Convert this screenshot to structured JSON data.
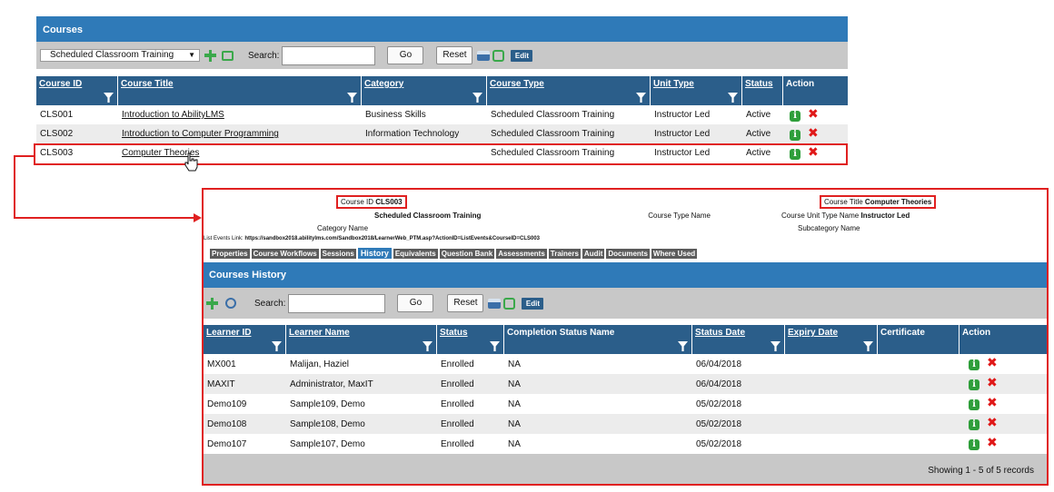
{
  "courses": {
    "title": "Courses",
    "filter_select": "Scheduled Classroom Training",
    "search_label": "Search:",
    "search_value": "",
    "go_label": "Go",
    "reset_label": "Reset",
    "edit_label": "Edit",
    "columns": [
      "Course ID",
      "Course Title",
      "Category",
      "Course Type",
      "Unit Type",
      "Status",
      "Action"
    ],
    "rows": [
      {
        "id": "CLS001",
        "title": "Introduction to AbilityLMS",
        "category": "Business Skills",
        "type": "Scheduled Classroom Training",
        "unit": "Instructor Led",
        "status": "Active"
      },
      {
        "id": "CLS002",
        "title": "Introduction to Computer Programming",
        "category": "Information Technology",
        "type": "Scheduled Classroom Training",
        "unit": "Instructor Led",
        "status": "Active"
      },
      {
        "id": "CLS003",
        "title": "Computer Theories",
        "category": "",
        "type": "Scheduled Classroom Training",
        "unit": "Instructor Led",
        "status": "Active"
      }
    ]
  },
  "detail": {
    "course_id_label": "Course ID",
    "course_id_value": "CLS003",
    "course_type_label": "Course Type Name",
    "course_type_value": "Scheduled Classroom Training",
    "category_label": "Category Name",
    "category_value": "",
    "course_title_label": "Course Title",
    "course_title_value": "Computer Theories",
    "unit_type_label": "Course Unit Type Name",
    "unit_type_value": "Instructor Led",
    "subcategory_label": "Subcategory Name",
    "subcategory_value": "",
    "list_events_label": "List Events Link:",
    "list_events_value": "https://sandbox2018.abilitylms.com/Sandbox2018/LearnerWeb_PTM.asp?ActionID=ListEvents&CourseID=CLS003",
    "tabs": [
      "Properties",
      "Course Workflows",
      "Sessions",
      "History",
      "Equivalents",
      "Question Bank",
      "Assessments",
      "Trainers",
      "Audit",
      "Documents",
      "Where Used"
    ],
    "active_tab": "History"
  },
  "history": {
    "title": "Courses History",
    "search_label": "Search:",
    "search_value": "",
    "go_label": "Go",
    "reset_label": "Reset",
    "edit_label": "Edit",
    "columns": [
      "Learner ID",
      "Learner Name",
      "Status",
      "Completion Status Name",
      "Status Date",
      "Expiry Date",
      "Certificate",
      "Action"
    ],
    "rows": [
      {
        "id": "MX001",
        "name": "Malijan, Haziel",
        "status": "Enrolled",
        "completion": "NA",
        "date": "06/04/2018",
        "expiry": "",
        "cert": ""
      },
      {
        "id": "MAXIT",
        "name": "Administrator, MaxIT",
        "status": "Enrolled",
        "completion": "NA",
        "date": "06/04/2018",
        "expiry": "",
        "cert": ""
      },
      {
        "id": "Demo109",
        "name": "Sample109, Demo",
        "status": "Enrolled",
        "completion": "NA",
        "date": "05/02/2018",
        "expiry": "",
        "cert": ""
      },
      {
        "id": "Demo108",
        "name": "Sample108, Demo",
        "status": "Enrolled",
        "completion": "NA",
        "date": "05/02/2018",
        "expiry": "",
        "cert": ""
      },
      {
        "id": "Demo107",
        "name": "Sample107, Demo",
        "status": "Enrolled",
        "completion": "NA",
        "date": "05/02/2018",
        "expiry": "",
        "cert": ""
      }
    ],
    "footer": "Showing 1 - 5 of 5 records"
  },
  "icons": {
    "funnel": "filter-funnel-icon",
    "info": "info-icon",
    "delete": "delete-x-icon",
    "add": "add-plus-icon",
    "print": "printer-icon",
    "export": "export-icon"
  },
  "colors": {
    "title_blue": "#2f7ab8",
    "header_blue": "#2b5e8a",
    "highlight_red": "#e02020",
    "info_green": "#2e9e3a"
  }
}
